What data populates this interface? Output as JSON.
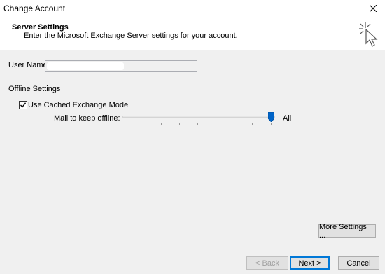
{
  "window": {
    "title": "Change Account",
    "close_icon": "close-icon"
  },
  "header": {
    "title": "Server Settings",
    "subtitle": "Enter the Microsoft Exchange Server settings for your account.",
    "icon": "cursor-click-icon"
  },
  "form": {
    "user_name_label": "User Name:",
    "user_name_value": "",
    "offline_settings_label": "Offline Settings",
    "cached_mode_label": "Use Cached Exchange Mode",
    "cached_mode_checked": true,
    "mail_offline_label": "Mail to keep offline:",
    "mail_offline_value_label": "All",
    "mail_offline_level": 1.0
  },
  "buttons": {
    "more_settings": "More Settings ...",
    "back": "< Back",
    "next": "Next >",
    "cancel": "Cancel"
  }
}
